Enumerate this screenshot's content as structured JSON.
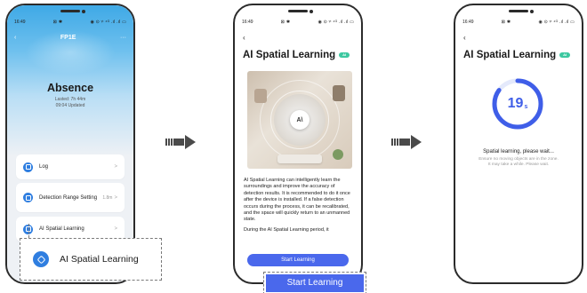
{
  "status_bar": {
    "time": "16:49",
    "icons_mid": "⊠ ✱",
    "icons_right": "◉ ⊙ ᵞᵗ ⁴ᴳ .ıl .ıl ▭"
  },
  "phone1": {
    "nav": {
      "back": "‹",
      "title": "FP1E",
      "more": "···"
    },
    "status": {
      "state": "Absence",
      "lasted": "Lasted: 7h 44m",
      "updated": "09:04 Updated"
    },
    "cards": [
      {
        "label": "Log",
        "value": "",
        "chevron": ">"
      },
      {
        "label": "Detection Range Setting",
        "value": "1.8m",
        "chevron": ">"
      },
      {
        "label": "AI Spatial Learning",
        "value": "",
        "chevron": ">"
      }
    ],
    "callout": {
      "label": "AI Spatial Learning",
      "icon": "cube-icon"
    }
  },
  "phone2": {
    "back": "‹",
    "title": "AI Spatial Learning",
    "badge": "AI",
    "image_logo": "A\\",
    "paragraphs": [
      "AI Spatial Learning can intelligently learn the surroundings and improve the accuracy of detection results. It is recommended to do it once after the device is installed. If a false detection occurs during the process, it can be recalibrated, and the space will quickly return to an unmanned state.",
      "During the AI Spatial Learning period, it"
    ],
    "button": "Start Learning",
    "callout_button": "Start Learning"
  },
  "phone3": {
    "back": "‹",
    "title": "AI Spatial Learning",
    "badge": "AI",
    "progress": {
      "value": "19",
      "unit": "s",
      "fraction": 0.85
    },
    "message": "Spatial learning, please wait...",
    "hint_line1": "Ensure no moving objects are in the zone.",
    "hint_line2": "It may take a while. Please wait."
  },
  "colors": {
    "accent": "#4a68ec",
    "icon_blue": "#2f7ee0",
    "badge": "#3cc8a0",
    "header": "#3fa9e6"
  }
}
